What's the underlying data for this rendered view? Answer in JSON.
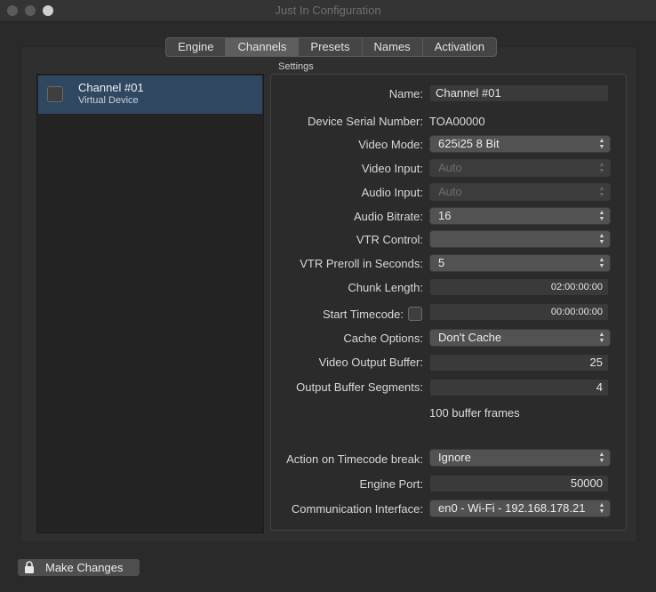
{
  "window": {
    "title": "Just In Configuration"
  },
  "tabs": [
    "Engine",
    "Channels",
    "Presets",
    "Names",
    "Activation"
  ],
  "active_tab": "Channels",
  "channels": [
    {
      "name": "Channel #01",
      "subtitle": "Virtual Device",
      "checked": false
    }
  ],
  "settings": {
    "section_title": "Settings",
    "name": {
      "label": "Name:",
      "value": "Channel #01"
    },
    "serial": {
      "label": "Device Serial Number:",
      "value": "TOA00000"
    },
    "video_mode": {
      "label": "Video Mode:",
      "value": "625i25 8 Bit"
    },
    "video_input": {
      "label": "Video Input:",
      "value": "Auto",
      "enabled": false
    },
    "audio_input": {
      "label": "Audio Input:",
      "value": "Auto",
      "enabled": false
    },
    "audio_bitrate": {
      "label": "Audio Bitrate:",
      "value": "16"
    },
    "vtr_control": {
      "label": "VTR Control:",
      "value": ""
    },
    "vtr_preroll": {
      "label": "VTR Preroll in Seconds:",
      "value": "5"
    },
    "chunk_length": {
      "label": "Chunk Length:",
      "value": "02:00:00:00"
    },
    "start_timecode": {
      "label": "Start Timecode:",
      "value": "00:00:00:00",
      "checked": false
    },
    "cache_options": {
      "label": "Cache Options:",
      "value": "Don't Cache"
    },
    "video_output_buffer": {
      "label": "Video Output Buffer:",
      "value": "25"
    },
    "output_buffer_segments": {
      "label": "Output Buffer Segments:",
      "value": "4"
    },
    "buffer_frames_note": "100 buffer frames",
    "timecode_break": {
      "label": "Action on Timecode break:",
      "value": "Ignore"
    },
    "engine_port": {
      "label": "Engine Port:",
      "value": "50000"
    },
    "comm_interface": {
      "label": "Communication Interface:",
      "value": "en0 - Wi-Fi - 192.168.178.21"
    }
  },
  "footer": {
    "make_changes_label": "Make Changes",
    "icon": "lock-icon"
  },
  "colors": {
    "selection": "#2f4760",
    "background": "#2a2a2a"
  }
}
